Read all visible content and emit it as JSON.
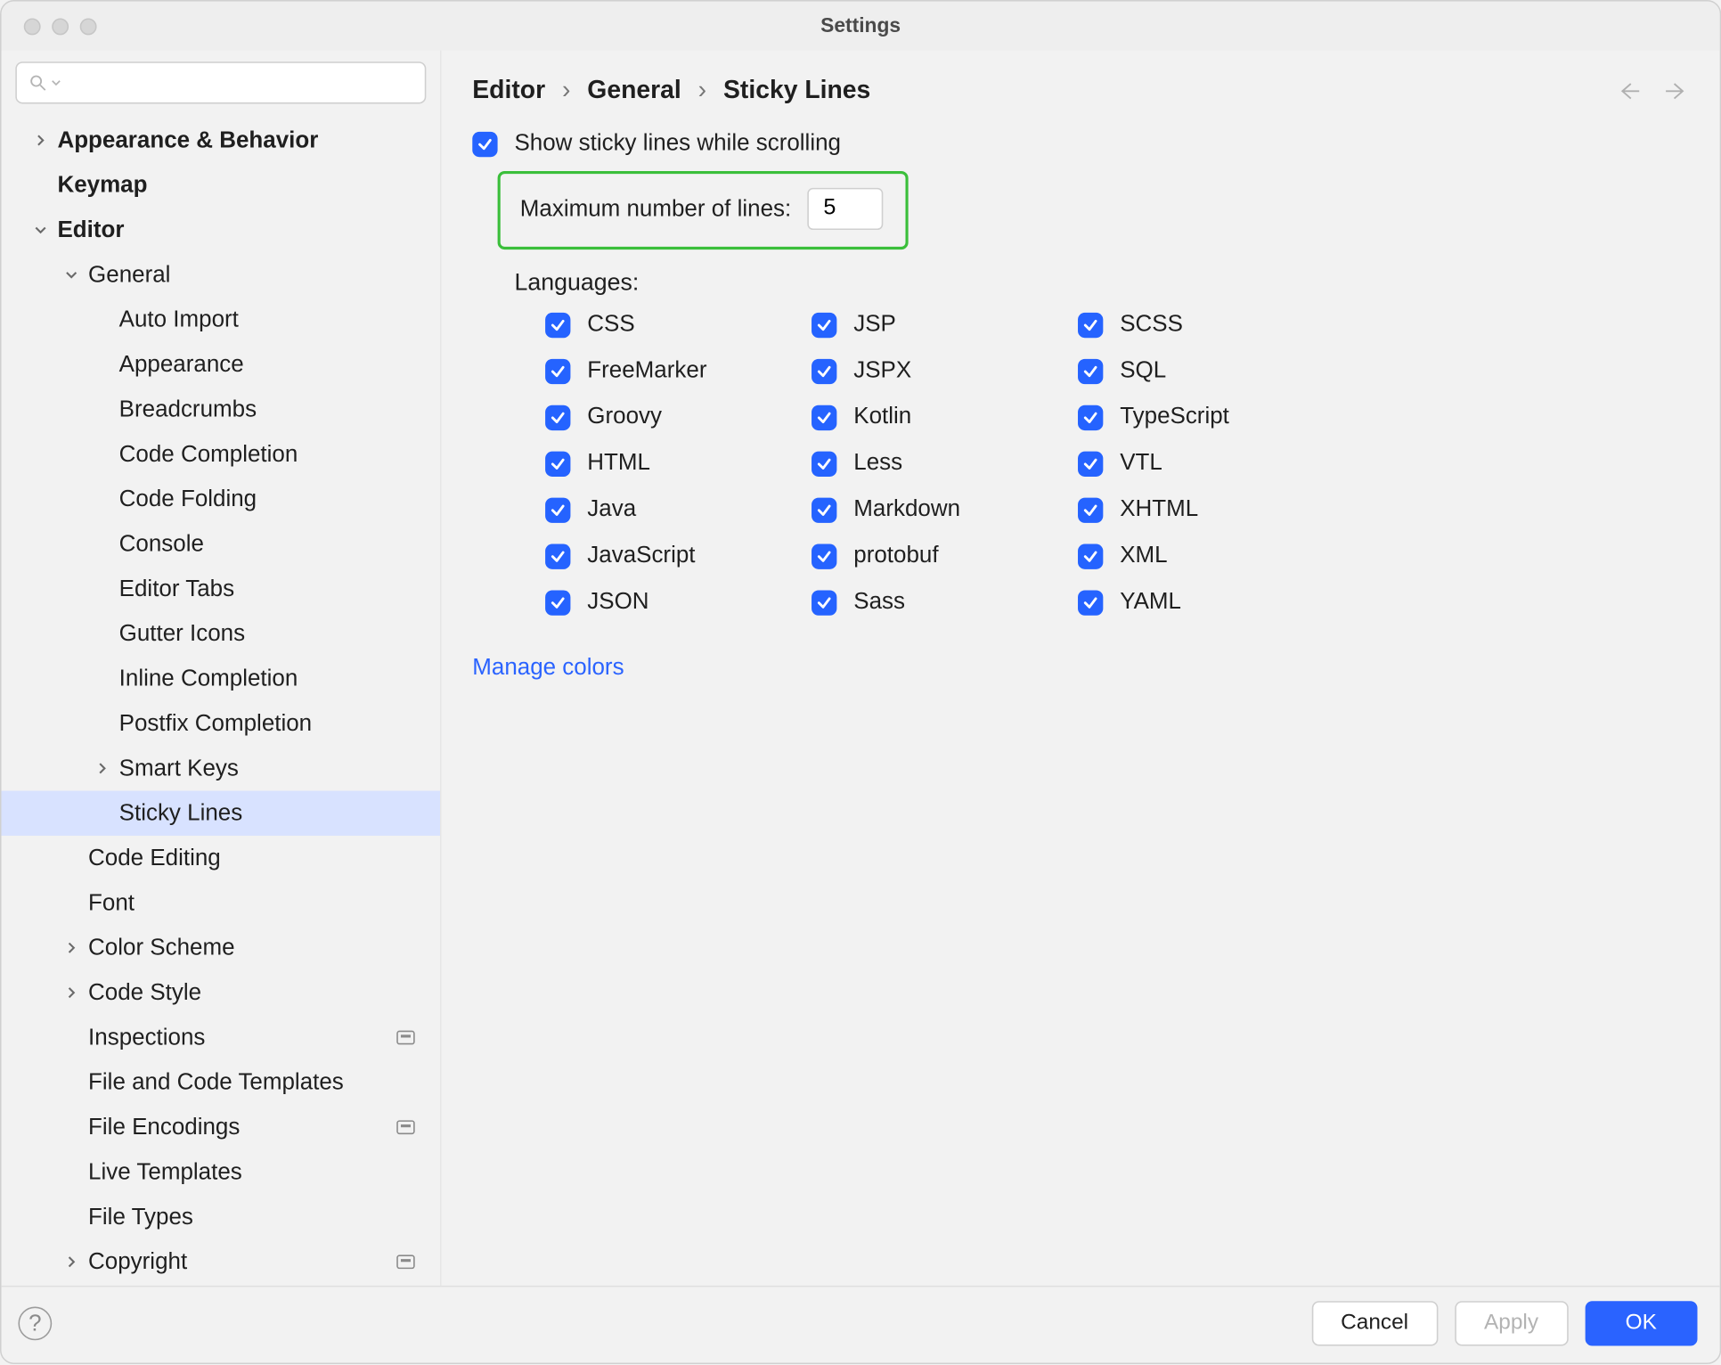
{
  "window": {
    "title": "Settings"
  },
  "breadcrumb": {
    "a": "Editor",
    "b": "General",
    "c": "Sticky Lines"
  },
  "sidebar": {
    "items": [
      {
        "label": "Appearance & Behavior",
        "indent": 0,
        "bold": true,
        "twisty": "right"
      },
      {
        "label": "Keymap",
        "indent": 0,
        "bold": true,
        "twisty": "none"
      },
      {
        "label": "Editor",
        "indent": 0,
        "bold": true,
        "twisty": "down"
      },
      {
        "label": "General",
        "indent": 1,
        "bold": false,
        "twisty": "down"
      },
      {
        "label": "Auto Import",
        "indent": 2,
        "bold": false,
        "twisty": "none"
      },
      {
        "label": "Appearance",
        "indent": 2,
        "bold": false,
        "twisty": "none"
      },
      {
        "label": "Breadcrumbs",
        "indent": 2,
        "bold": false,
        "twisty": "none"
      },
      {
        "label": "Code Completion",
        "indent": 2,
        "bold": false,
        "twisty": "none"
      },
      {
        "label": "Code Folding",
        "indent": 2,
        "bold": false,
        "twisty": "none"
      },
      {
        "label": "Console",
        "indent": 2,
        "bold": false,
        "twisty": "none"
      },
      {
        "label": "Editor Tabs",
        "indent": 2,
        "bold": false,
        "twisty": "none"
      },
      {
        "label": "Gutter Icons",
        "indent": 2,
        "bold": false,
        "twisty": "none"
      },
      {
        "label": "Inline Completion",
        "indent": 2,
        "bold": false,
        "twisty": "none"
      },
      {
        "label": "Postfix Completion",
        "indent": 2,
        "bold": false,
        "twisty": "none"
      },
      {
        "label": "Smart Keys",
        "indent": 2,
        "bold": false,
        "twisty": "right"
      },
      {
        "label": "Sticky Lines",
        "indent": 2,
        "bold": false,
        "twisty": "none",
        "selected": true
      },
      {
        "label": "Code Editing",
        "indent": 1,
        "bold": false,
        "twisty": "none"
      },
      {
        "label": "Font",
        "indent": 1,
        "bold": false,
        "twisty": "none"
      },
      {
        "label": "Color Scheme",
        "indent": 1,
        "bold": false,
        "twisty": "right"
      },
      {
        "label": "Code Style",
        "indent": 1,
        "bold": false,
        "twisty": "right"
      },
      {
        "label": "Inspections",
        "indent": 1,
        "bold": false,
        "twisty": "none",
        "badge": true
      },
      {
        "label": "File and Code Templates",
        "indent": 1,
        "bold": false,
        "twisty": "none"
      },
      {
        "label": "File Encodings",
        "indent": 1,
        "bold": false,
        "twisty": "none",
        "badge": true
      },
      {
        "label": "Live Templates",
        "indent": 1,
        "bold": false,
        "twisty": "none"
      },
      {
        "label": "File Types",
        "indent": 1,
        "bold": false,
        "twisty": "none"
      },
      {
        "label": "Copyright",
        "indent": 1,
        "bold": false,
        "twisty": "right",
        "badge": true
      }
    ]
  },
  "main": {
    "show_sticky": "Show sticky lines while scrolling",
    "max_label": "Maximum number of lines:",
    "max_value": "5",
    "languages_label": "Languages:",
    "languages": [
      "CSS",
      "JSP",
      "SCSS",
      "FreeMarker",
      "JSPX",
      "SQL",
      "Groovy",
      "Kotlin",
      "TypeScript",
      "HTML",
      "Less",
      "VTL",
      "Java",
      "Markdown",
      "XHTML",
      "JavaScript",
      "protobuf",
      "XML",
      "JSON",
      "Sass",
      "YAML"
    ],
    "manage_colors": "Manage colors"
  },
  "footer": {
    "cancel": "Cancel",
    "apply": "Apply",
    "ok": "OK"
  }
}
